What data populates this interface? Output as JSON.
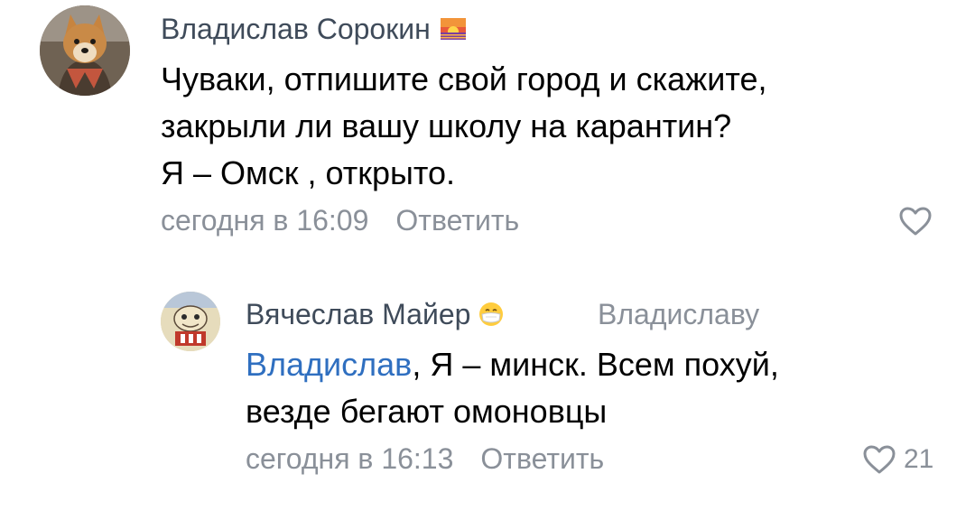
{
  "comments": [
    {
      "author": "Владислав Сорокин",
      "author_emoji": "sunset-emoji",
      "avatar": "shiba-dog-avatar",
      "text_lines": [
        "Чуваки, отпишите свой город и скажите,",
        "закрыли ли вашу школу на карантин?",
        "Я – Омск , открыто."
      ],
      "time": "сегодня в 16:09",
      "reply_label": "Ответить",
      "likes": ""
    },
    {
      "author": "Вячеслав Майер",
      "author_emoji": "face-with-medical-mask-emoji",
      "avatar": "cartoon-avatar",
      "reply_to": "Владиславу",
      "mention": "Владислав",
      "text_first_rest": ", Я – минск. Всем похуй,",
      "text_second": "везде бегают омоновцы",
      "time": "сегодня в 16:13",
      "reply_label": "Ответить",
      "likes": "21"
    }
  ],
  "colors": {
    "author": "#3f4b5a",
    "meta": "#8a9099",
    "mention": "#2f6fc0",
    "text": "#000000"
  }
}
